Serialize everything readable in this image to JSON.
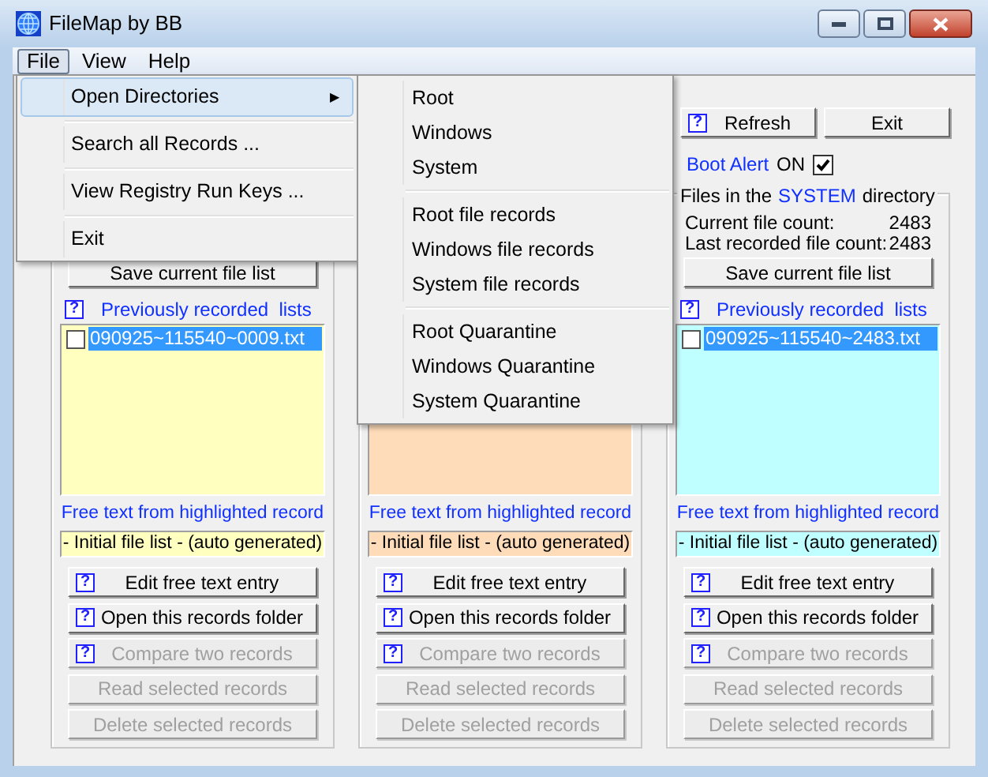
{
  "window": {
    "title": "FileMap by BB"
  },
  "menu_bar": [
    {
      "label": "File",
      "selected": true
    },
    {
      "label": "View",
      "selected": false
    },
    {
      "label": "Help",
      "selected": false
    }
  ],
  "file_menu": [
    {
      "kind": "submenu",
      "label": "Open Directories",
      "arrow": "▶",
      "selected": true
    },
    {
      "kind": "separator"
    },
    {
      "kind": "item",
      "label": "Search all Records ...",
      "selected": false
    },
    {
      "kind": "separator"
    },
    {
      "kind": "item",
      "label": "View Registry Run Keys ...",
      "selected": false
    },
    {
      "kind": "separator"
    },
    {
      "kind": "item",
      "label": "Exit",
      "selected": false
    }
  ],
  "submenu": [
    {
      "kind": "item",
      "label": "Root"
    },
    {
      "kind": "item",
      "label": "Windows"
    },
    {
      "kind": "item",
      "label": "System"
    },
    {
      "kind": "separator"
    },
    {
      "kind": "item",
      "label": "Root file records"
    },
    {
      "kind": "item",
      "label": "Windows file records"
    },
    {
      "kind": "item",
      "label": "System file records"
    },
    {
      "kind": "separator"
    },
    {
      "kind": "item",
      "label": "Root Quarantine"
    },
    {
      "kind": "item",
      "label": "Windows Quarantine"
    },
    {
      "kind": "item",
      "label": "System Quarantine"
    }
  ],
  "panels": [
    {
      "color": "#ffffc0",
      "save_button": "Save current file list",
      "lists_label": {
        "help": "?",
        "label": "Previously recorded  lists"
      },
      "records": [
        {
          "name": "090925~115540~0009.txt",
          "checked": false,
          "selected": true
        }
      ],
      "free_text_label": "Free text from highlighted record",
      "free_text_value": "- Initial file list - (auto generated)",
      "buttons": [
        {
          "help": "?",
          "label": "Edit free text entry",
          "disabled": false
        },
        {
          "help": "?",
          "label": "Open this records folder",
          "disabled": false
        },
        {
          "help": "?",
          "label": "Compare two records",
          "disabled": true
        },
        {
          "label": "Read selected records",
          "disabled": true
        },
        {
          "label": "Delete selected records",
          "disabled": true
        }
      ]
    },
    {
      "color": "#ffdcb9",
      "free_text_label": "Free text from highlighted record",
      "free_text_value": "- Initial file list - (auto generated)",
      "buttons": [
        {
          "help": "?",
          "label": "Edit free text entry",
          "disabled": false
        },
        {
          "help": "?",
          "label": "Open this records folder",
          "disabled": false
        },
        {
          "help": "?",
          "label": "Compare two records",
          "disabled": true
        },
        {
          "label": "Read selected records",
          "disabled": true
        },
        {
          "label": "Delete selected records",
          "disabled": true
        }
      ]
    },
    {
      "color": "#c0ffff",
      "top_buttons": [
        {
          "help": "?",
          "label": "Refresh"
        },
        {
          "label": "Exit"
        }
      ],
      "boot_alert": {
        "label": "Boot Alert",
        "state_label": "ON",
        "checked": true
      },
      "group_title": {
        "prefix": "Files in the",
        "name": "SYSTEM",
        "suffix": "directory"
      },
      "counts": [
        {
          "label": "Current file count:",
          "value": "2483"
        },
        {
          "label": "Last recorded file count:",
          "value": "2483"
        }
      ],
      "save_button": "Save current file list",
      "lists_label": {
        "help": "?",
        "label": "Previously recorded  lists"
      },
      "records": [
        {
          "name": "090925~115540~2483.txt",
          "checked": false,
          "selected": true
        }
      ],
      "free_text_label": "Free text from highlighted record",
      "free_text_value": "- Initial file list - (auto generated)",
      "buttons": [
        {
          "help": "?",
          "label": "Edit free text entry",
          "disabled": false
        },
        {
          "help": "?",
          "label": "Open this records folder",
          "disabled": false
        },
        {
          "help": "?",
          "label": "Compare two records",
          "disabled": true
        },
        {
          "label": "Read selected records",
          "disabled": true
        },
        {
          "label": "Delete selected records",
          "disabled": true
        }
      ]
    }
  ]
}
